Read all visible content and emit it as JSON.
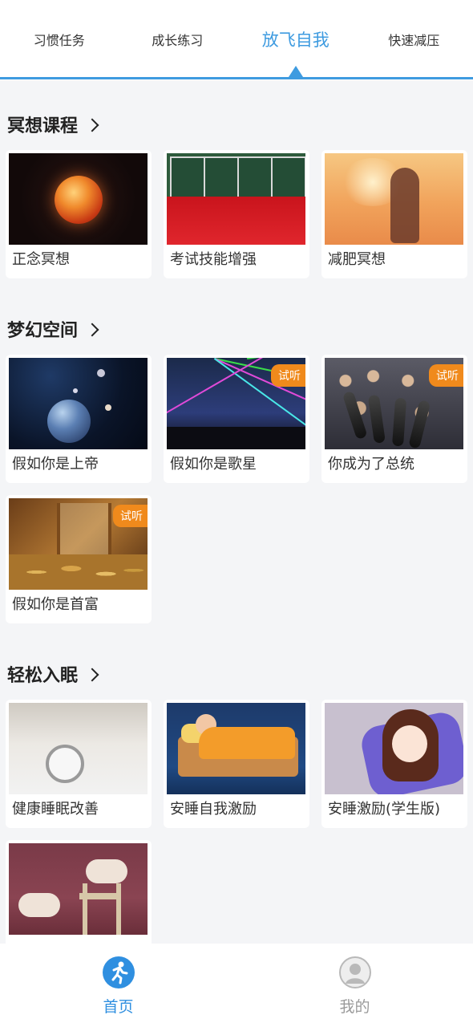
{
  "tabs": [
    {
      "label": "习惯任务"
    },
    {
      "label": "成长练习"
    },
    {
      "label": "放飞自我"
    },
    {
      "label": "快速减压"
    }
  ],
  "active_tab": "放飞自我",
  "sections": [
    {
      "title": "冥想课程",
      "cards": [
        {
          "label": "正念冥想",
          "badge": ""
        },
        {
          "label": "考试技能增强",
          "badge": ""
        },
        {
          "label": "减肥冥想",
          "badge": ""
        }
      ]
    },
    {
      "title": "梦幻空间",
      "cards": [
        {
          "label": "假如你是上帝",
          "badge": ""
        },
        {
          "label": "假如你是歌星",
          "badge": "试听"
        },
        {
          "label": "你成为了总统",
          "badge": "试听"
        },
        {
          "label": "假如你是首富",
          "badge": "试听"
        }
      ]
    },
    {
      "title": "轻松入眠",
      "cards": [
        {
          "label": "健康睡眠改善",
          "badge": ""
        },
        {
          "label": "安睡自我激励",
          "badge": ""
        },
        {
          "label": "安睡激励(学生版)",
          "badge": ""
        },
        {
          "label": "",
          "badge": ""
        }
      ]
    }
  ],
  "bottom_nav": [
    {
      "label": "首页",
      "icon": "runner-icon"
    },
    {
      "label": "我的",
      "icon": "user-avatar-icon"
    }
  ],
  "colors": {
    "accent": "#3e9be0",
    "badge": "#f08a1c",
    "background": "#f4f5f7"
  }
}
